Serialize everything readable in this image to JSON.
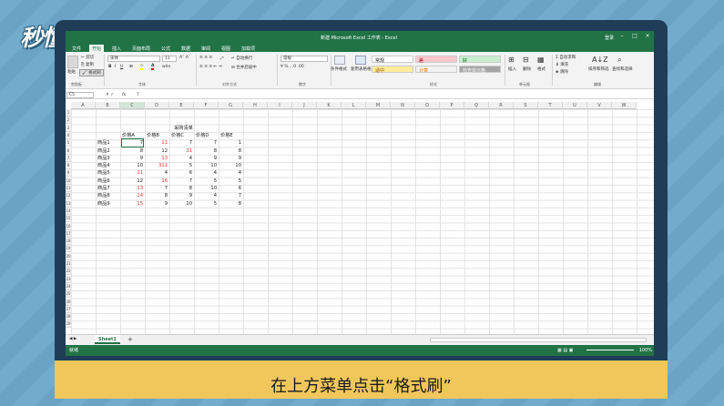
{
  "logo": "秒懂视频",
  "window": {
    "title": "新建 Microsoft Excel 工作表 - Excel",
    "login": "登录"
  },
  "tabs": [
    "文件",
    "开始",
    "插入",
    "页面布局",
    "公式",
    "数据",
    "审阅",
    "视图",
    "加载项"
  ],
  "ribbon": {
    "clipboard": {
      "paste": "粘贴",
      "cut": "剪切",
      "copy": "复制",
      "format_painter": "格式刷",
      "group": "剪贴板"
    },
    "font": {
      "name": "宋体",
      "size": "11",
      "group": "字体",
      "bold": "B",
      "italic": "I",
      "underline": "U"
    },
    "alignment": {
      "wrap": "自动换行",
      "merge": "合并后居中",
      "group": "对齐方式"
    },
    "number": {
      "format": "常规",
      "group": "数字"
    },
    "styles": {
      "conditional": "条件格式",
      "table": "套用表格格式",
      "group": "样式",
      "items": [
        {
          "label": "常规",
          "bg": "#ffffff",
          "fg": "#222222"
        },
        {
          "label": "差",
          "bg": "#ffc7ce",
          "fg": "#9c0006"
        },
        {
          "label": "好",
          "bg": "#c6efce",
          "fg": "#006100"
        },
        {
          "label": "适中",
          "bg": "#ffeb9c",
          "fg": "#9c5700"
        },
        {
          "label": "计算",
          "bg": "#f2f2f2",
          "fg": "#fa7d00"
        },
        {
          "label": "检查单元格",
          "bg": "#a5a5a5",
          "fg": "#ffffff"
        }
      ]
    },
    "cells": {
      "insert": "插入",
      "delete": "删除",
      "format": "格式",
      "group": "单元格"
    },
    "editing": {
      "autosum": "自动求和",
      "fill": "填充",
      "clear": "清除",
      "sort": "排序和筛选",
      "find": "查找和选择",
      "group": "编辑"
    }
  },
  "formula_bar": {
    "name_box": "C5",
    "fx": "fx",
    "value": "7"
  },
  "columns": [
    "A",
    "B",
    "C",
    "D",
    "E",
    "F",
    "G",
    "H",
    "I",
    "J",
    "K",
    "L",
    "M",
    "N",
    "O",
    "P",
    "Q",
    "R",
    "S",
    "T",
    "U",
    "V",
    "W"
  ],
  "table": {
    "title": "采购清单",
    "headers": [
      "价格A",
      "价格B",
      "价格C",
      "价格D",
      "价格E"
    ],
    "rows": [
      {
        "name": "商品1",
        "values": [
          7,
          11,
          7,
          7,
          1
        ],
        "red": [
          false,
          true,
          false,
          false,
          false
        ]
      },
      {
        "name": "商品2",
        "values": [
          8,
          12,
          31,
          8,
          8
        ],
        "red": [
          false,
          false,
          true,
          false,
          false
        ]
      },
      {
        "name": "商品3",
        "values": [
          9,
          13,
          4,
          9,
          9
        ],
        "red": [
          false,
          true,
          false,
          false,
          false
        ]
      },
      {
        "name": "商品4",
        "values": [
          10,
          311,
          5,
          10,
          10
        ],
        "red": [
          false,
          true,
          false,
          false,
          false
        ]
      },
      {
        "name": "商品5",
        "values": [
          11,
          4,
          6,
          4,
          4
        ],
        "red": [
          true,
          false,
          false,
          false,
          false
        ]
      },
      {
        "name": "商品6",
        "values": [
          12,
          16,
          7,
          5,
          5
        ],
        "red": [
          false,
          true,
          false,
          false,
          false
        ]
      },
      {
        "name": "商品7",
        "values": [
          13,
          7,
          8,
          10,
          6
        ],
        "red": [
          true,
          false,
          false,
          false,
          false
        ]
      },
      {
        "name": "商品8",
        "values": [
          14,
          8,
          9,
          4,
          7
        ],
        "red": [
          true,
          false,
          false,
          false,
          false
        ]
      },
      {
        "name": "商品9",
        "values": [
          15,
          9,
          10,
          5,
          8
        ],
        "red": [
          true,
          false,
          false,
          false,
          false
        ]
      }
    ]
  },
  "sheet": {
    "tab": "Sheet1",
    "add": "+"
  },
  "status": {
    "ready": "就绪",
    "zoom": "100%"
  },
  "caption": "在上方菜单点击“格式刷”"
}
